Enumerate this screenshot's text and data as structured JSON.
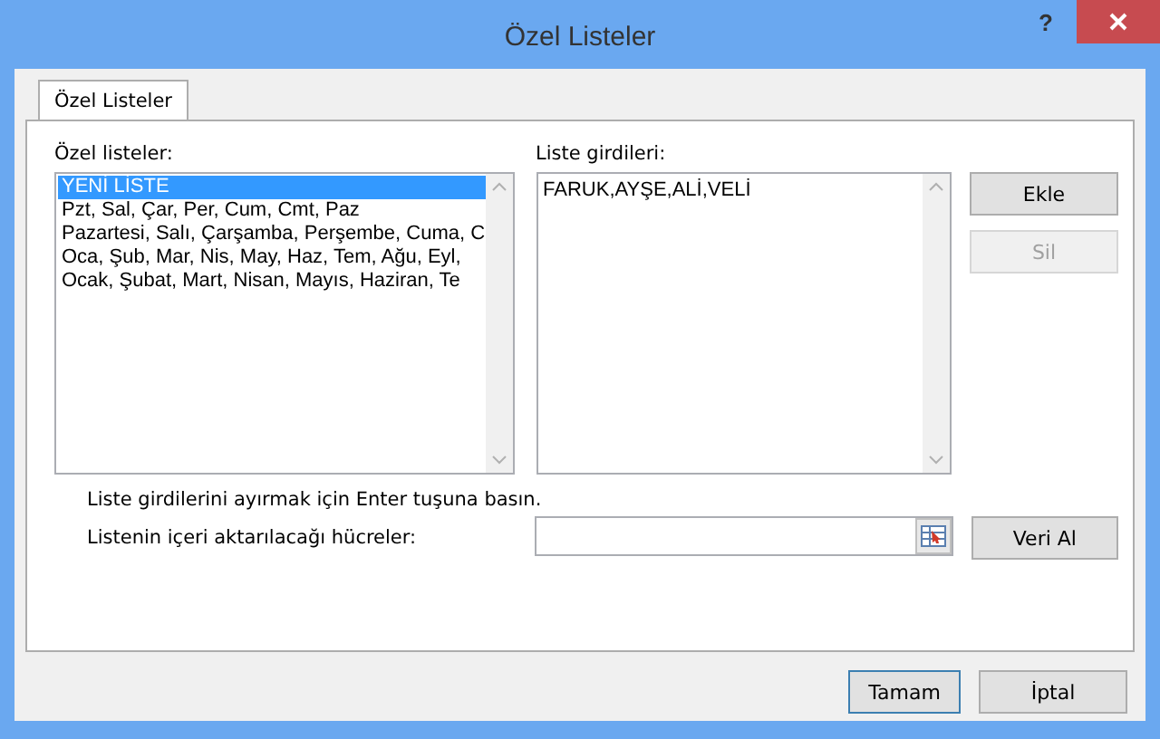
{
  "window": {
    "title": "Özel Listeler",
    "help": "?"
  },
  "tabs": [
    {
      "label": "Özel Listeler",
      "selected": true
    }
  ],
  "lists": {
    "label": "Özel listeler:",
    "items": [
      {
        "text": "YENİ LİSTE",
        "selected": true
      },
      {
        "text": "Pzt, Sal, Çar, Per, Cum, Cmt, Paz",
        "selected": false
      },
      {
        "text": "Pazartesi, Salı, Çarşamba, Perşembe, Cuma, C",
        "selected": false
      },
      {
        "text": "Oca, Şub, Mar, Nis, May, Haz, Tem, Ağu, Eyl,",
        "selected": false
      },
      {
        "text": "Ocak, Şubat, Mart, Nisan, Mayıs, Haziran, Te",
        "selected": false
      }
    ]
  },
  "entries": {
    "label": "Liste girdileri:",
    "value": "FARUK,AYŞE,ALİ,VELİ"
  },
  "side_buttons": [
    {
      "label": "Ekle",
      "disabled": false
    },
    {
      "label": "Sil",
      "disabled": true
    }
  ],
  "hint": "Liste girdilerini ayırmak için Enter tuşuna basın.",
  "import": {
    "label": "Listenin içeri aktarılacağı hücreler:",
    "button": "Veri Al"
  },
  "footer_buttons": [
    {
      "label": "Tamam",
      "default": true
    },
    {
      "label": "İptal",
      "default": false
    }
  ]
}
